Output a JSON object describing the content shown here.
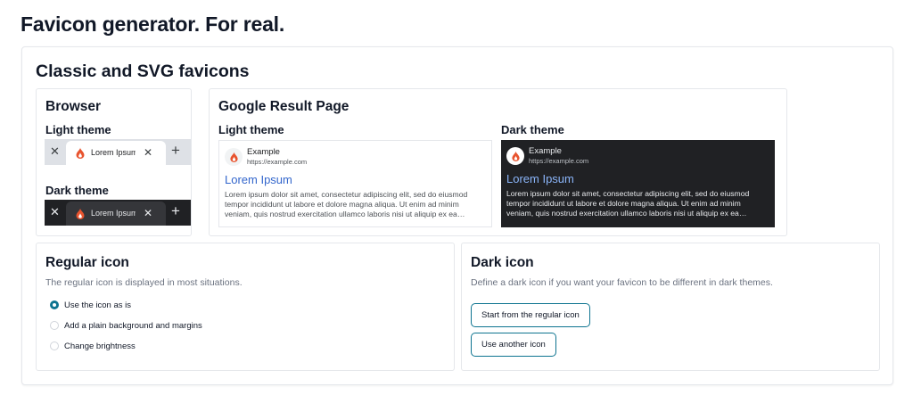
{
  "page": {
    "title": "Favicon generator. For real."
  },
  "section": {
    "title": "Classic and SVG favicons"
  },
  "browser": {
    "title": "Browser",
    "light_label": "Light theme",
    "dark_label": "Dark theme",
    "tab": {
      "close_glyph": "✕",
      "label": "Lorem Ipsum",
      "tab_close_glyph": "✕",
      "new_tab_glyph": "+"
    }
  },
  "google": {
    "title": "Google Result Page",
    "light_label": "Light theme",
    "dark_label": "Dark theme",
    "result": {
      "site": "Example",
      "url": "https://example.com",
      "link": "Lorem Ipsum",
      "snippet": "Lorem ipsum dolor sit amet, consectetur adipiscing elit, sed do eiusmod tempor incididunt ut labore et dolore magna aliqua. Ut enim ad minim veniam, quis nostrud exercitation ullamco laboris nisi ut aliquip ex ea commodo consequat."
    }
  },
  "regular_icon": {
    "title": "Regular icon",
    "description": "The regular icon is displayed in most situations.",
    "options": [
      {
        "label": "Use the icon as is",
        "checked": true
      },
      {
        "label": "Add a plain background and margins",
        "checked": false
      },
      {
        "label": "Change brightness",
        "checked": false
      }
    ]
  },
  "dark_icon": {
    "title": "Dark icon",
    "description": "Define a dark icon if you want your favicon to be different in dark themes.",
    "button_regular": "Start from the regular icon",
    "button_another": "Use another icon"
  },
  "colors": {
    "accent": "#0e7490",
    "favicon_primary": "#e8542f",
    "favicon_highlight": "#ffffff",
    "dark_tabbar": "#202124",
    "dark_serp": "#202124",
    "link_light": "#3366cc",
    "link_dark": "#8ab4f8"
  },
  "icons": {
    "favicon": "flame-drop-icon",
    "tab_close": "close-icon",
    "new_tab": "plus-icon"
  }
}
